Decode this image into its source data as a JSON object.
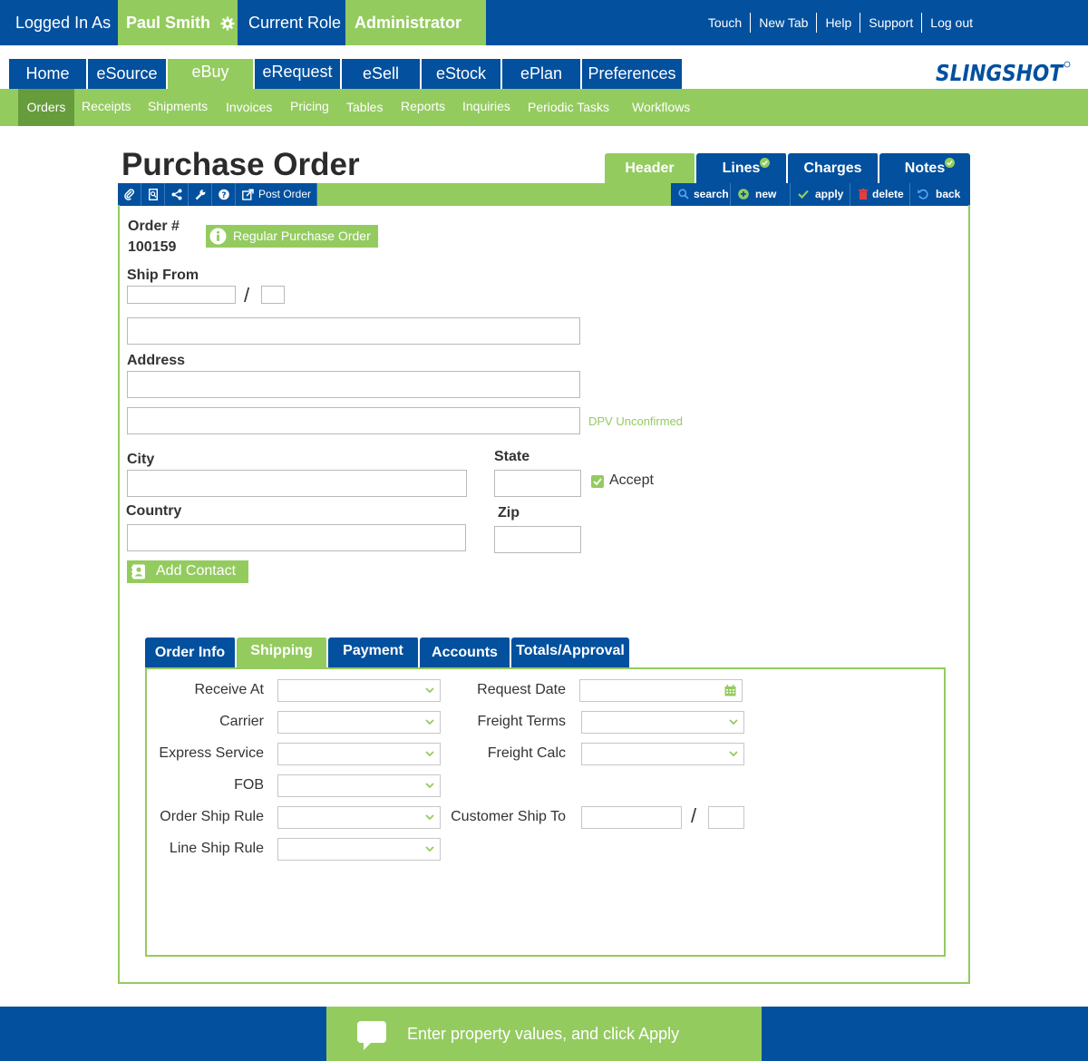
{
  "topbar": {
    "logged_in_label": "Logged In As",
    "user_name": "Paul Smith",
    "role_label": "Current Role",
    "role_value": "Administrator",
    "links": [
      "Touch",
      "New Tab",
      "Help",
      "Support",
      "Log out"
    ]
  },
  "modules": [
    "Home",
    "eSource",
    "eBuy",
    "eRequest",
    "eSell",
    "eStock",
    "ePlan",
    "Preferences"
  ],
  "active_module": "eBuy",
  "logo_text": "SLINGSHOT",
  "subnav": [
    "Orders",
    "Receipts",
    "Shipments",
    "Invoices",
    "Pricing",
    "Tables",
    "Reports",
    "Inquiries",
    "Periodic Tasks",
    "Workflows"
  ],
  "active_subnav": "Orders",
  "page": {
    "title": "Purchase Order",
    "tabs": [
      "Header",
      "Lines",
      "Charges",
      "Notes"
    ],
    "active_tab": "Header"
  },
  "toolbar": {
    "post_order": "Post Order",
    "search": "search",
    "new": "new",
    "apply": "apply",
    "delete": "delete",
    "back": "back"
  },
  "form": {
    "order_label": "Order #",
    "order_number": "100159",
    "order_type": "Regular Purchase Order",
    "ship_from_label": "Ship From",
    "ship_from_separator": "/",
    "address_label": "Address",
    "dpv_status": "DPV Unconfirmed",
    "city_label": "City",
    "state_label": "State",
    "accept_label": "Accept",
    "country_label": "Country",
    "zip_label": "Zip",
    "add_contact": "Add Contact"
  },
  "inner_tabs": [
    "Order Info",
    "Shipping",
    "Payment",
    "Accounts",
    "Totals/Approval"
  ],
  "active_inner_tab": "Shipping",
  "shipping": {
    "receive_at": "Receive At",
    "carrier": "Carrier",
    "express_service": "Express Service",
    "fob": "FOB",
    "order_ship_rule": "Order Ship Rule",
    "line_ship_rule": "Line Ship Rule",
    "request_date": "Request Date",
    "freight_terms": "Freight Terms",
    "freight_calc": "Freight Calc",
    "customer_ship_to": "Customer Ship To",
    "customer_ship_to_separator": "/"
  },
  "footer": {
    "message": "Enter property values, and click Apply"
  },
  "colors": {
    "blue": "#02509e",
    "green": "#94cb5f",
    "dark_green": "#679c3c"
  }
}
